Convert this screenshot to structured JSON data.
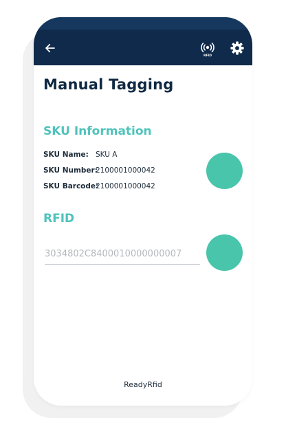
{
  "header": {
    "back_icon": "arrow-left-icon",
    "rfid_icon": "rfid-antenna-icon",
    "rfid_icon_caption": "RFID",
    "settings_icon": "gear-icon"
  },
  "page": {
    "title": "Manual Tagging"
  },
  "sku": {
    "section_title": "SKU Information",
    "name_label": "SKU Name:",
    "name_value": "SKU A",
    "number_label": "SKU Number:",
    "number_value": "2100001000042",
    "barcode_label": "SKU Barcode:",
    "barcode_value": "2100001000042"
  },
  "rfid": {
    "section_title": "RFID",
    "tag_value": "3034802C8400010000000007"
  },
  "footer": {
    "brand": "ReadyRfid"
  },
  "colors": {
    "header_bg": "#0f2a4a",
    "title": "#102a43",
    "accent": "#4fc3bc",
    "action_circle": "#48c5aa"
  }
}
